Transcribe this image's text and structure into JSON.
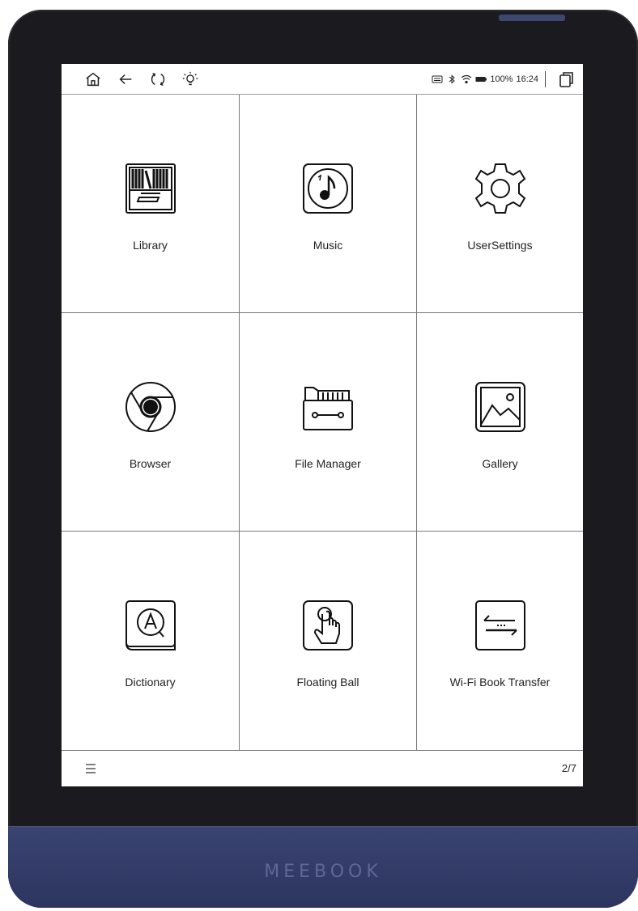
{
  "statusbar": {
    "battery_text": "100%",
    "time": "16:24"
  },
  "apps": [
    {
      "label": "Library",
      "icon": "library-icon"
    },
    {
      "label": "Music",
      "icon": "music-icon"
    },
    {
      "label": "UserSettings",
      "icon": "settings-gear-icon"
    },
    {
      "label": "Browser",
      "icon": "browser-icon"
    },
    {
      "label": "File Manager",
      "icon": "file-manager-icon"
    },
    {
      "label": "Gallery",
      "icon": "gallery-icon"
    },
    {
      "label": "Dictionary",
      "icon": "dictionary-icon"
    },
    {
      "label": "Floating Ball",
      "icon": "floating-ball-icon"
    },
    {
      "label": "Wi-Fi Book Transfer",
      "icon": "wifi-transfer-icon"
    }
  ],
  "bottombar": {
    "page_indicator": "2/7"
  },
  "device": {
    "brand": "MEEBOOK"
  }
}
